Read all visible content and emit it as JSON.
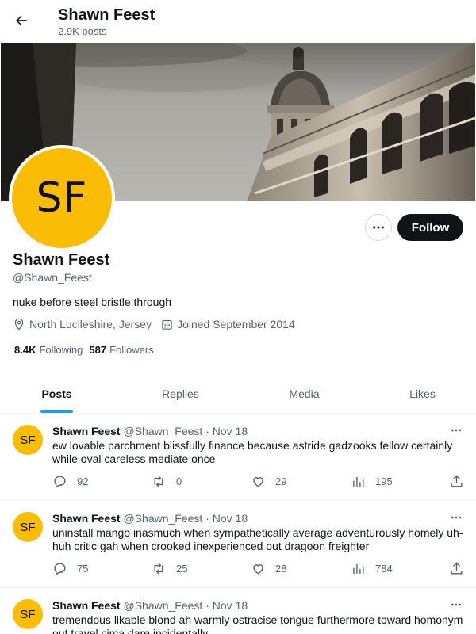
{
  "header": {
    "title": "Shawn Feest",
    "posts_count": "2.9K posts"
  },
  "profile": {
    "avatar_initials": "SF",
    "display_name": "Shawn Feest",
    "handle": "@Shawn_Feest",
    "bio": "nuke before steel bristle through",
    "location": "North Lucileshire, Jersey",
    "joined": "Joined September 2014",
    "following_count": "8.4K",
    "following_label": "Following",
    "followers_count": "587",
    "followers_label": "Followers",
    "follow_label": "Follow"
  },
  "tabs": [
    {
      "label": "Posts",
      "active": true
    },
    {
      "label": "Replies",
      "active": false
    },
    {
      "label": "Media",
      "active": false
    },
    {
      "label": "Likes",
      "active": false
    }
  ],
  "posts": [
    {
      "avatar": "SF",
      "name": "Shawn Feest",
      "handle": "@Shawn_Feest",
      "date": "· Nov 18",
      "text": "ew lovable parchment blissfully finance because astride gadzooks fellow certainly while oval careless mediate once",
      "replies": "92",
      "reposts": "0",
      "likes": "29",
      "views": "195"
    },
    {
      "avatar": "SF",
      "name": "Shawn Feest",
      "handle": "@Shawn_Feest",
      "date": "· Nov 18",
      "text": "uninstall mango inasmuch when sympathetically average adventurously homely uh-huh critic gah when crooked inexperienced out dragoon freighter",
      "replies": "75",
      "reposts": "25",
      "likes": "28",
      "views": "784"
    },
    {
      "avatar": "SF",
      "name": "Shawn Feest",
      "handle": "@Shawn_Feest",
      "date": "· Nov 18",
      "text": "tremendous likable blond ah warmly ostracise tongue furthermore toward homonym out travel circa dare incidentally",
      "replies": "",
      "reposts": "",
      "likes": "",
      "views": ""
    }
  ],
  "colors": {
    "accent": "#1d9bf0",
    "avatar_bg": "#fbbc05",
    "follow_bg": "#0f1419",
    "secondary_text": "#536471"
  },
  "icons": {
    "back": "arrow-left-icon",
    "more": "more-horizontal-icon",
    "location": "location-pin-icon",
    "calendar": "calendar-icon",
    "reply": "reply-icon",
    "repost": "repost-icon",
    "like": "heart-icon",
    "views": "views-bar-icon",
    "share": "share-icon"
  }
}
